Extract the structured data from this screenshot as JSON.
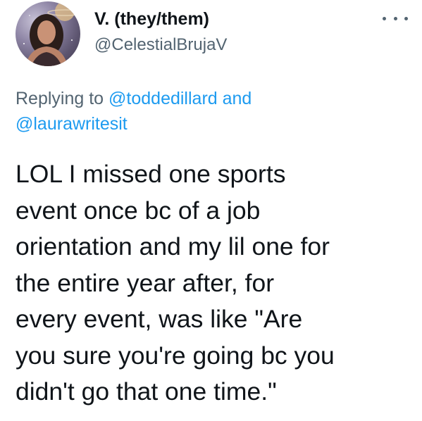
{
  "author": {
    "display_name": "V. (they/them)",
    "handle": "@CelestialBrujaV"
  },
  "more_icon": "more-horizontal-icon",
  "reply": {
    "prefix": "Replying to ",
    "mention_1": "@toddedillard",
    "joiner": " and",
    "mention_2": "@laurawritesit"
  },
  "tweet_text": "LOL I missed one sports\nevent once bc of a job\norientation and my lil one for\nthe entire year after, for\nevery event, was like \"Are\nyou sure you're going bc you\ndidn't go that one time.\"",
  "colors": {
    "text": "#0f1419",
    "secondary": "#536471",
    "link": "#1d9bf0"
  }
}
